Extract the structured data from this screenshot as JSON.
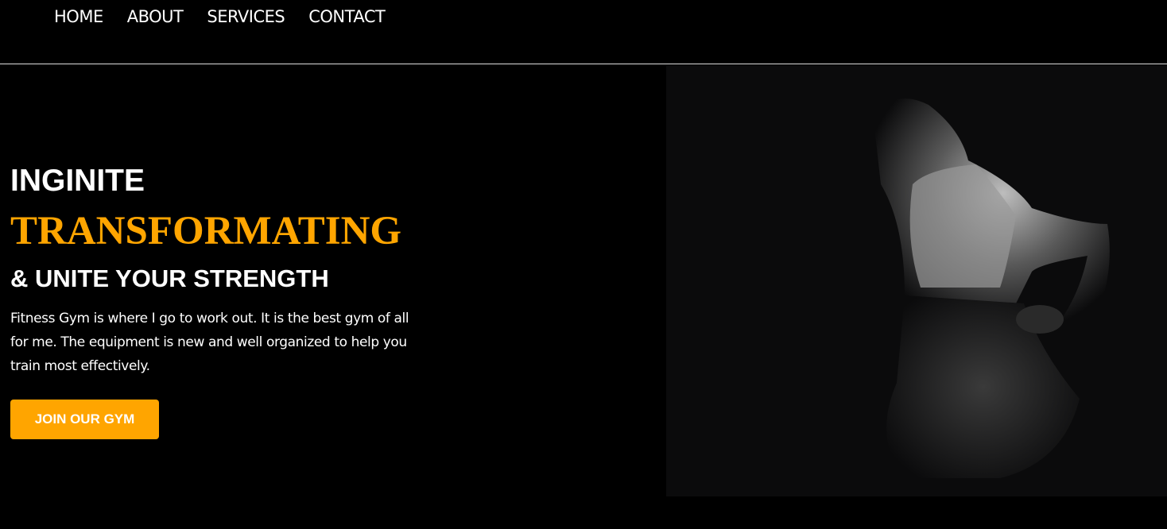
{
  "nav": {
    "items": [
      "HOME",
      "ABOUT",
      "SERVICES",
      "CONTACT"
    ]
  },
  "hero": {
    "line1": "INGINITE",
    "line2": "TRANSFORMATING",
    "line3": "& UNITE YOUR STRENGTH",
    "description": "Fitness Gym is where I go to work out. It is the best gym of all for me. The equipment is new and well organized to help you train most effectively.",
    "cta_label": "JOIN OUR GYM",
    "accent_color": "#ffa500"
  }
}
